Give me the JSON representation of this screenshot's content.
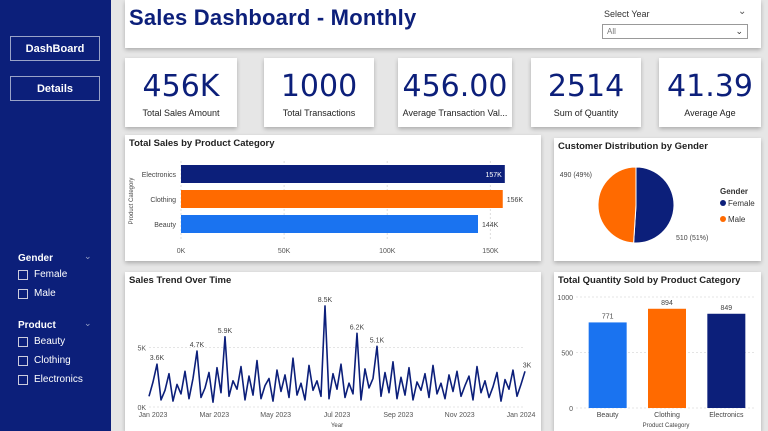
{
  "sidebar": {
    "nav": [
      "DashBoard",
      "Details"
    ],
    "gender": {
      "title": "Gender",
      "items": [
        "Female",
        "Male"
      ]
    },
    "product": {
      "title": "Product",
      "items": [
        "Beauty",
        "Clothing",
        "Electronics"
      ]
    }
  },
  "header": {
    "title": "Sales Dashboard - Monthly",
    "year_label": "Select Year",
    "year_value": "All"
  },
  "kpis": [
    {
      "value": "456K",
      "label": "Total Sales Amount"
    },
    {
      "value": "1000",
      "label": "Total Transactions"
    },
    {
      "value": "456.00",
      "label": "Average Transaction Val..."
    },
    {
      "value": "2514",
      "label": "Sum of Quantity"
    },
    {
      "value": "41.39",
      "label": "Average Age"
    }
  ],
  "colors": {
    "navy": "#0c1f7a",
    "orange": "#ff6a00",
    "blue": "#1a73f0"
  },
  "chart_data": [
    {
      "type": "bar",
      "orientation": "horizontal",
      "title": "Total Sales by Product Category",
      "ylabel": "Product Category",
      "categories": [
        "Electronics",
        "Clothing",
        "Beauty"
      ],
      "values": [
        157,
        156,
        144
      ],
      "data_labels": [
        "157K",
        "156K",
        "144K"
      ],
      "xticks": [
        "0K",
        "50K",
        "100K",
        "150K"
      ],
      "xlim": [
        0,
        160
      ],
      "colors": [
        "#0c1f7a",
        "#ff6a00",
        "#1a73f0"
      ]
    },
    {
      "type": "pie",
      "title": "Customer Distribution by Gender",
      "legend_title": "Gender",
      "legend": [
        "Female",
        "Male"
      ],
      "values": [
        510,
        490
      ],
      "data_labels": [
        "510 (51%)",
        "490 (49%)"
      ],
      "colors": [
        "#0c1f7a",
        "#ff6a00"
      ]
    },
    {
      "type": "line",
      "title": "Sales Trend Over Time",
      "xlabel": "Year",
      "xticks": [
        "Jan 2023",
        "Mar 2023",
        "May 2023",
        "Jul 2023",
        "Sep 2023",
        "Nov 2023",
        "Jan 2024"
      ],
      "yticks": [
        "0K",
        "5K"
      ],
      "ylim": [
        0,
        9.5
      ],
      "peak_labels": [
        "3.6K",
        "4.7K",
        "5.9K",
        "8.5K",
        "6.2K",
        "5.1K",
        "3K"
      ],
      "values": [
        0.9,
        2.1,
        3.6,
        0.6,
        1.4,
        2.8,
        0.5,
        1.9,
        1.1,
        3.0,
        0.7,
        2.4,
        4.7,
        0.8,
        1.6,
        2.9,
        0.4,
        3.3,
        1.2,
        5.9,
        0.9,
        2.2,
        1.5,
        3.4,
        0.6,
        2.6,
        1.0,
        3.9,
        0.7,
        1.8,
        2.4,
        0.5,
        3.1,
        1.3,
        2.7,
        0.8,
        4.1,
        1.0,
        2.0,
        0.6,
        3.5,
        1.4,
        2.2,
        0.9,
        8.5,
        0.7,
        2.8,
        1.5,
        3.6,
        0.8,
        2.0,
        1.1,
        6.2,
        0.6,
        3.2,
        1.6,
        2.4,
        5.1,
        0.9,
        2.9,
        1.2,
        3.8,
        0.7,
        2.5,
        1.0,
        3.3,
        0.6,
        2.1,
        1.4,
        2.8,
        0.8,
        3.5,
        1.1,
        2.0,
        0.7,
        2.7,
        1.3,
        3.0,
        0.9,
        1.8,
        2.6,
        0.6,
        3.4,
        1.2,
        2.2,
        0.8,
        1.7,
        2.9,
        0.5,
        2.3,
        1.5,
        3.1,
        0.9,
        1.9,
        3.0
      ]
    },
    {
      "type": "bar",
      "title": "Total Quantity Sold by Product Category",
      "xlabel": "Product Category",
      "categories": [
        "Beauty",
        "Clothing",
        "Electronics"
      ],
      "values": [
        771,
        894,
        849
      ],
      "yticks": [
        "0",
        "500",
        "1000"
      ],
      "ylim": [
        0,
        1000
      ],
      "colors": [
        "#1a73f0",
        "#ff6a00",
        "#0c1f7a"
      ]
    }
  ]
}
